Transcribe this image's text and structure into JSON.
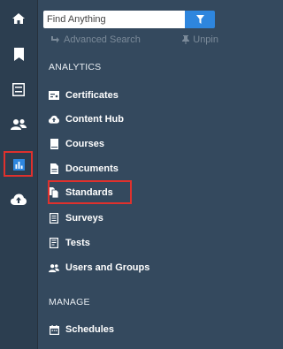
{
  "search": {
    "placeholder": "Find Anything"
  },
  "links": {
    "advanced_search": "Advanced Search",
    "unpin": "Unpin"
  },
  "sections": {
    "analytics": "ANALYTICS",
    "manage": "MANAGE"
  },
  "analytics_items": [
    {
      "label": "Certificates",
      "icon": "certificate-icon"
    },
    {
      "label": "Content Hub",
      "icon": "cloud-icon"
    },
    {
      "label": "Courses",
      "icon": "book-icon"
    },
    {
      "label": "Documents",
      "icon": "document-icon"
    },
    {
      "label": "Standards",
      "icon": "standards-icon",
      "selected": true
    },
    {
      "label": "Surveys",
      "icon": "survey-icon"
    },
    {
      "label": "Tests",
      "icon": "test-icon"
    },
    {
      "label": "Users and Groups",
      "icon": "users-icon"
    }
  ],
  "manage_items": [
    {
      "label": "Schedules",
      "icon": "calendar-icon"
    }
  ],
  "rail": [
    {
      "icon": "home-icon"
    },
    {
      "icon": "bookmark-icon"
    },
    {
      "icon": "panel-icon"
    },
    {
      "icon": "users-icon"
    },
    {
      "icon": "analytics-icon",
      "active": true
    },
    {
      "icon": "cloud-upload-icon"
    }
  ],
  "colors": {
    "accent": "#2e86de",
    "highlight": "#e0312d",
    "panel": "#34495e",
    "rail": "#2c3e50"
  }
}
